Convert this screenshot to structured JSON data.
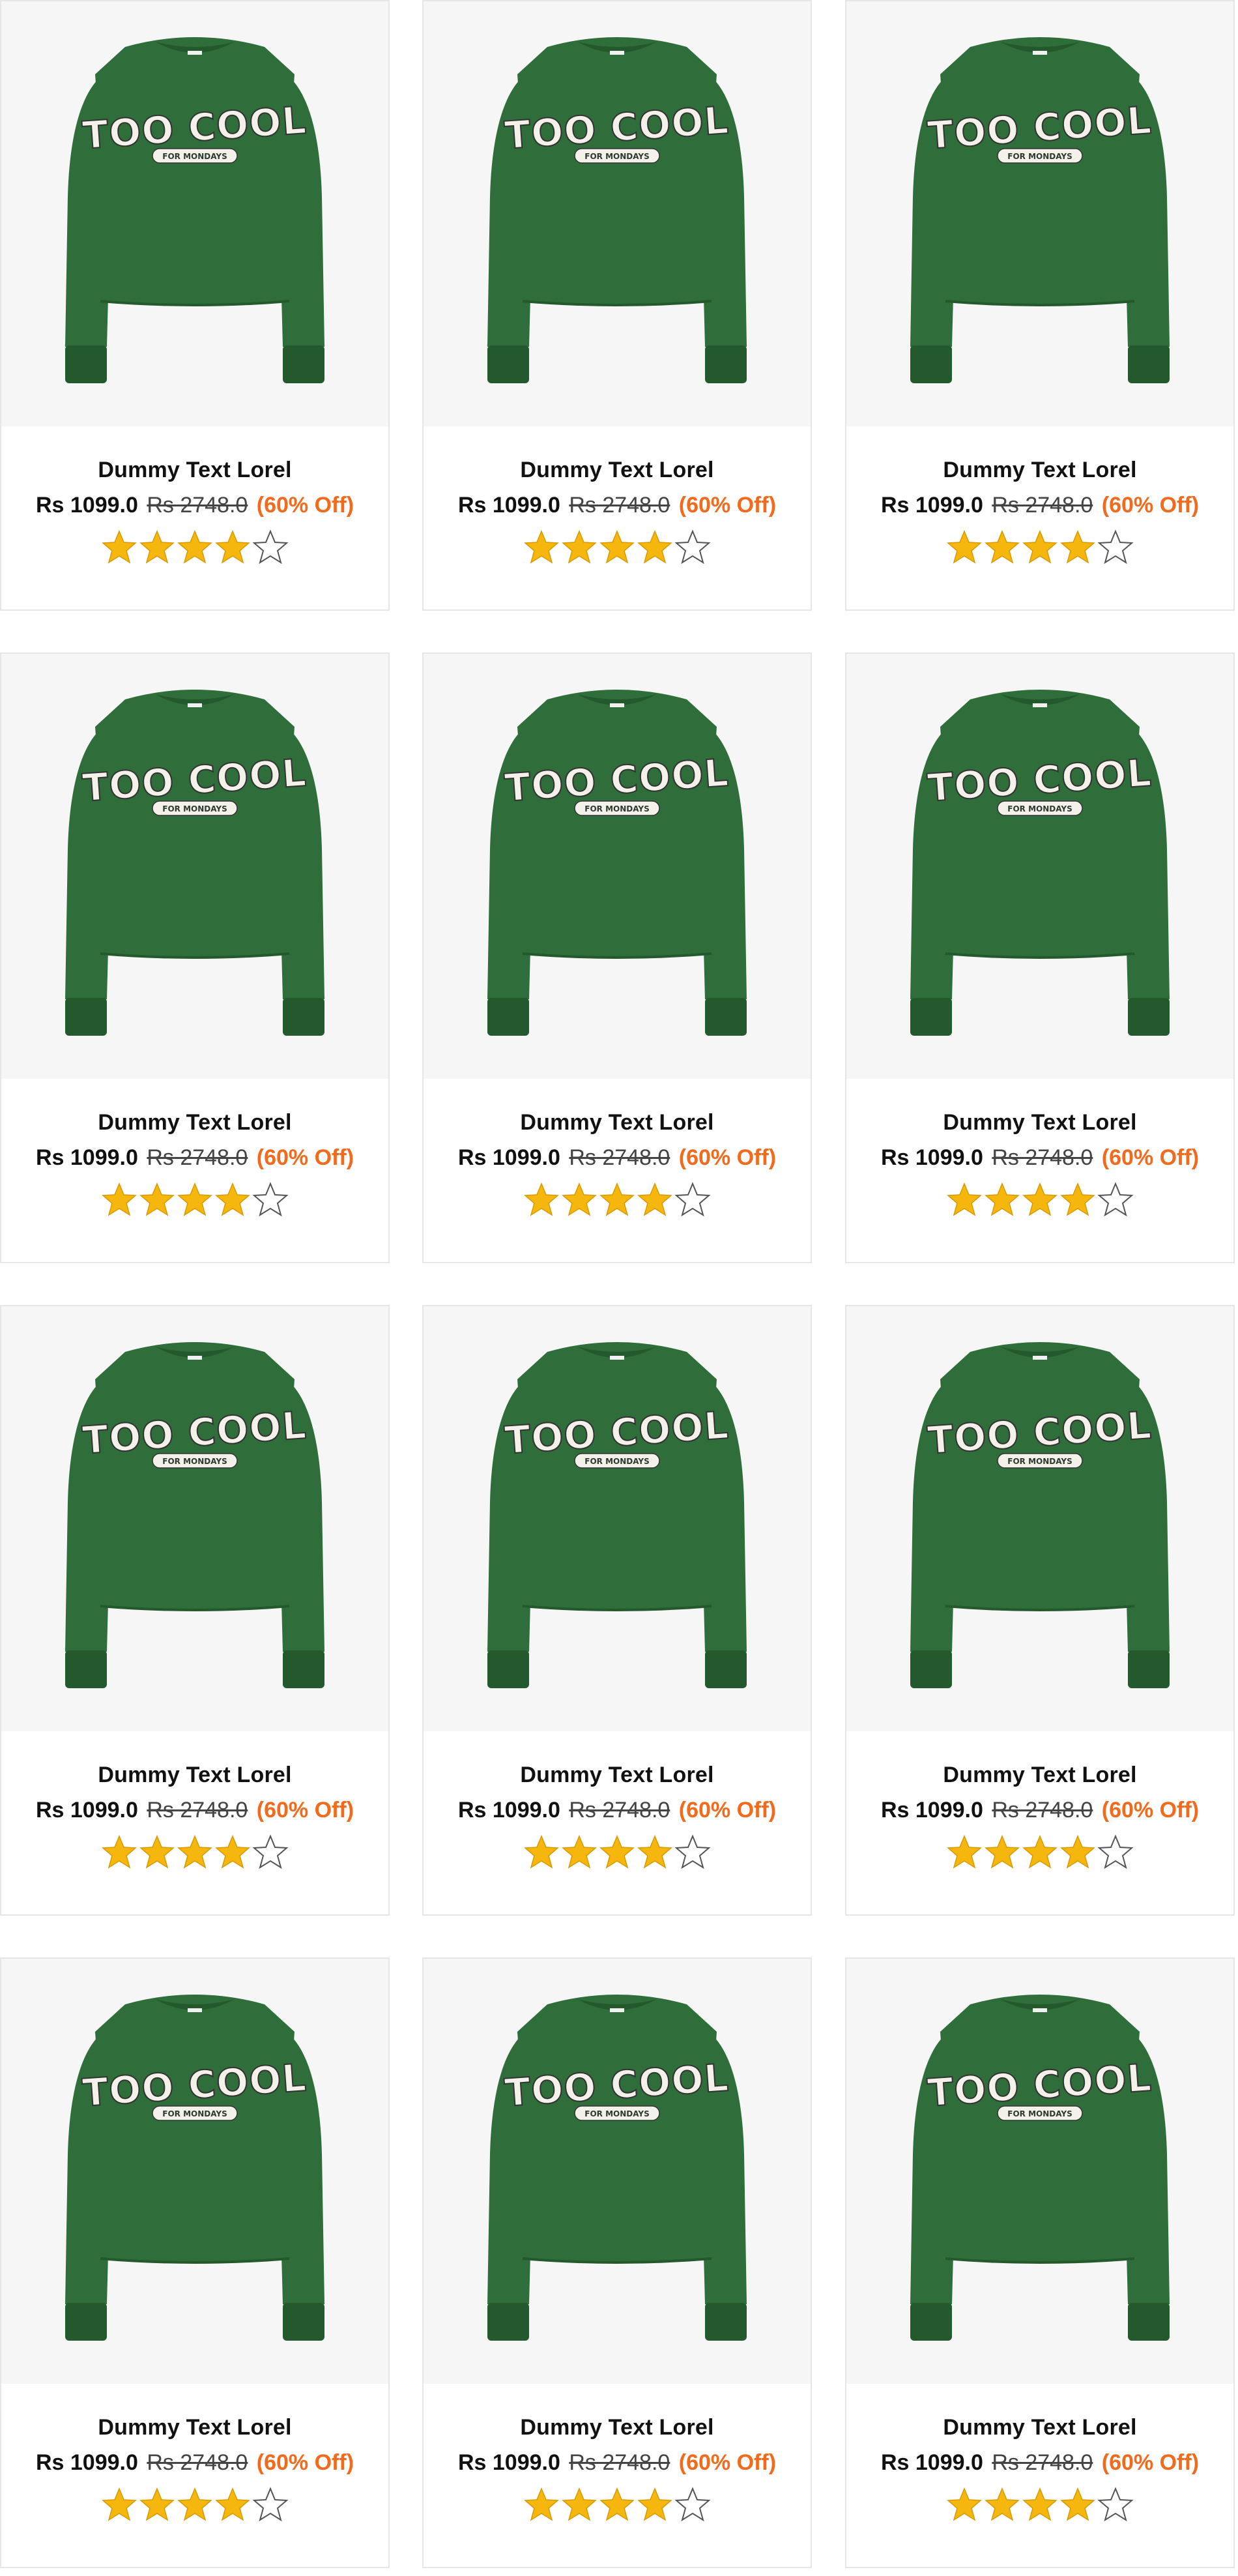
{
  "product_grid": {
    "products": [
      {
        "title": "Dummy Text Lorel",
        "price": "Rs 1099.0",
        "mrp": "Rs 2748.0",
        "discount": "(60% Off)",
        "rating": 4,
        "rating_max": 5,
        "image_icon": "green-sweatshirt-image",
        "print_text": "TOO COOL",
        "print_subtext": "FOR MONDAYS"
      },
      {
        "title": "Dummy Text Lorel",
        "price": "Rs 1099.0",
        "mrp": "Rs 2748.0",
        "discount": "(60% Off)",
        "rating": 4,
        "rating_max": 5,
        "image_icon": "green-sweatshirt-image",
        "print_text": "TOO COOL",
        "print_subtext": "FOR MONDAYS"
      },
      {
        "title": "Dummy Text Lorel",
        "price": "Rs 1099.0",
        "mrp": "Rs 2748.0",
        "discount": "(60% Off)",
        "rating": 4,
        "rating_max": 5,
        "image_icon": "green-sweatshirt-image",
        "print_text": "TOO COOL",
        "print_subtext": "FOR MONDAYS"
      },
      {
        "title": "Dummy Text Lorel",
        "price": "Rs 1099.0",
        "mrp": "Rs 2748.0",
        "discount": "(60% Off)",
        "rating": 4,
        "rating_max": 5,
        "image_icon": "green-sweatshirt-image",
        "print_text": "TOO COOL",
        "print_subtext": "FOR MONDAYS"
      },
      {
        "title": "Dummy Text Lorel",
        "price": "Rs 1099.0",
        "mrp": "Rs 2748.0",
        "discount": "(60% Off)",
        "rating": 4,
        "rating_max": 5,
        "image_icon": "green-sweatshirt-image",
        "print_text": "TOO COOL",
        "print_subtext": "FOR MONDAYS"
      },
      {
        "title": "Dummy Text Lorel",
        "price": "Rs 1099.0",
        "mrp": "Rs 2748.0",
        "discount": "(60% Off)",
        "rating": 4,
        "rating_max": 5,
        "image_icon": "green-sweatshirt-image",
        "print_text": "TOO COOL",
        "print_subtext": "FOR MONDAYS"
      },
      {
        "title": "Dummy Text Lorel",
        "price": "Rs 1099.0",
        "mrp": "Rs 2748.0",
        "discount": "(60% Off)",
        "rating": 4,
        "rating_max": 5,
        "image_icon": "green-sweatshirt-image",
        "print_text": "TOO COOL",
        "print_subtext": "FOR MONDAYS"
      },
      {
        "title": "Dummy Text Lorel",
        "price": "Rs 1099.0",
        "mrp": "Rs 2748.0",
        "discount": "(60% Off)",
        "rating": 4,
        "rating_max": 5,
        "image_icon": "green-sweatshirt-image",
        "print_text": "TOO COOL",
        "print_subtext": "FOR MONDAYS"
      },
      {
        "title": "Dummy Text Lorel",
        "price": "Rs 1099.0",
        "mrp": "Rs 2748.0",
        "discount": "(60% Off)",
        "rating": 4,
        "rating_max": 5,
        "image_icon": "green-sweatshirt-image",
        "print_text": "TOO COOL",
        "print_subtext": "FOR MONDAYS"
      },
      {
        "title": "Dummy Text Lorel",
        "price": "Rs 1099.0",
        "mrp": "Rs 2748.0",
        "discount": "(60% Off)",
        "rating": 4,
        "rating_max": 5,
        "image_icon": "green-sweatshirt-image",
        "print_text": "TOO COOL",
        "print_subtext": "FOR MONDAYS"
      },
      {
        "title": "Dummy Text Lorel",
        "price": "Rs 1099.0",
        "mrp": "Rs 2748.0",
        "discount": "(60% Off)",
        "rating": 4,
        "rating_max": 5,
        "image_icon": "green-sweatshirt-image",
        "print_text": "TOO COOL",
        "print_subtext": "FOR MONDAYS"
      },
      {
        "title": "Dummy Text Lorel",
        "price": "Rs 1099.0",
        "mrp": "Rs 2748.0",
        "discount": "(60% Off)",
        "rating": 4,
        "rating_max": 5,
        "image_icon": "green-sweatshirt-image",
        "print_text": "TOO COOL",
        "print_subtext": "FOR MONDAYS"
      }
    ]
  },
  "colors": {
    "sweatshirt": "#2f6e3a",
    "sweatshirt_dark": "#24592e",
    "discount": "#f26a1b",
    "star_filled": "#f5b60d",
    "card_border": "#e6e6e6",
    "image_bg": "#f6f6f6"
  },
  "icons": {
    "star_filled": "star-filled-icon",
    "star_empty": "star-outline-icon"
  }
}
